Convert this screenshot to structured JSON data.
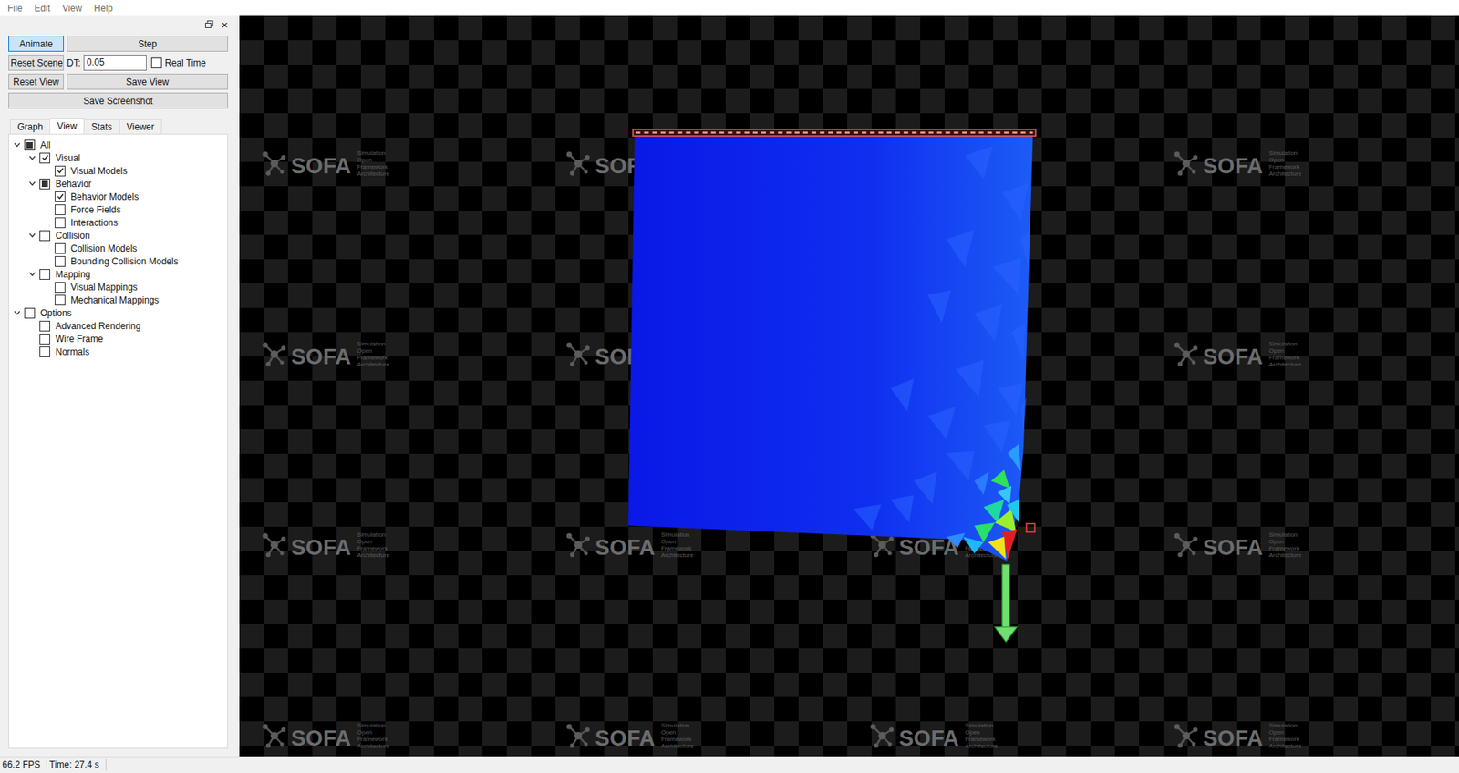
{
  "window": {
    "title": "SOFA"
  },
  "menu": [
    "File",
    "Edit",
    "View",
    "Help"
  ],
  "dock": {
    "close": "×"
  },
  "controls": {
    "animate": {
      "label": "Animate",
      "selected": true
    },
    "step": "Step",
    "reset_scene": "Reset Scene",
    "dt_label": "DT:",
    "dt_value": "0.05",
    "real_time": {
      "label": "Real Time",
      "checked": false
    },
    "reset_view": "Reset View",
    "save_view": "Save View",
    "save_screenshot": "Save Screenshot"
  },
  "tabs": [
    {
      "label": "Graph",
      "selected": false
    },
    {
      "label": "View",
      "selected": true
    },
    {
      "label": "Stats",
      "selected": false
    },
    {
      "label": "Viewer",
      "selected": false
    }
  ],
  "tree": [
    {
      "label": "All",
      "checked": false,
      "partial": true,
      "expanded": true,
      "children": [
        {
          "label": "Visual",
          "checked": true,
          "partial": false,
          "expanded": true,
          "children": [
            {
              "label": "Visual Models",
              "checked": true,
              "partial": false,
              "expanded": false,
              "children": []
            }
          ]
        },
        {
          "label": "Behavior",
          "checked": false,
          "partial": true,
          "expanded": true,
          "children": [
            {
              "label": "Behavior Models",
              "checked": true,
              "partial": false,
              "expanded": false,
              "children": []
            },
            {
              "label": "Force Fields",
              "checked": false,
              "partial": false,
              "expanded": false,
              "children": []
            },
            {
              "label": "Interactions",
              "checked": false,
              "partial": false,
              "expanded": false,
              "children": []
            }
          ]
        },
        {
          "label": "Collision",
          "checked": false,
          "partial": false,
          "expanded": true,
          "children": [
            {
              "label": "Collision Models",
              "checked": false,
              "partial": false,
              "expanded": false,
              "children": []
            },
            {
              "label": "Bounding Collision Models",
              "checked": false,
              "partial": false,
              "expanded": false,
              "children": []
            }
          ]
        },
        {
          "label": "Mapping",
          "checked": false,
          "partial": false,
          "expanded": true,
          "children": [
            {
              "label": "Visual Mappings",
              "checked": false,
              "partial": false,
              "expanded": false,
              "children": []
            },
            {
              "label": "Mechanical Mappings",
              "checked": false,
              "partial": false,
              "expanded": false,
              "children": []
            }
          ]
        }
      ]
    },
    {
      "label": "Options",
      "checked": false,
      "partial": false,
      "expanded": true,
      "children": [
        {
          "label": "Advanced Rendering",
          "checked": false,
          "partial": false,
          "expanded": false,
          "children": []
        },
        {
          "label": "Wire Frame",
          "checked": false,
          "partial": false,
          "expanded": false,
          "children": []
        },
        {
          "label": "Normals",
          "checked": false,
          "partial": false,
          "expanded": false,
          "children": []
        }
      ]
    }
  ],
  "viewport": {
    "watermark": {
      "logo": "SOFA",
      "tagline": [
        "Simulation",
        "Open",
        "Framework",
        "Architecture"
      ]
    }
  },
  "status_bar": {
    "fps": "66.2 FPS",
    "time": "Time: 27.4 s"
  }
}
